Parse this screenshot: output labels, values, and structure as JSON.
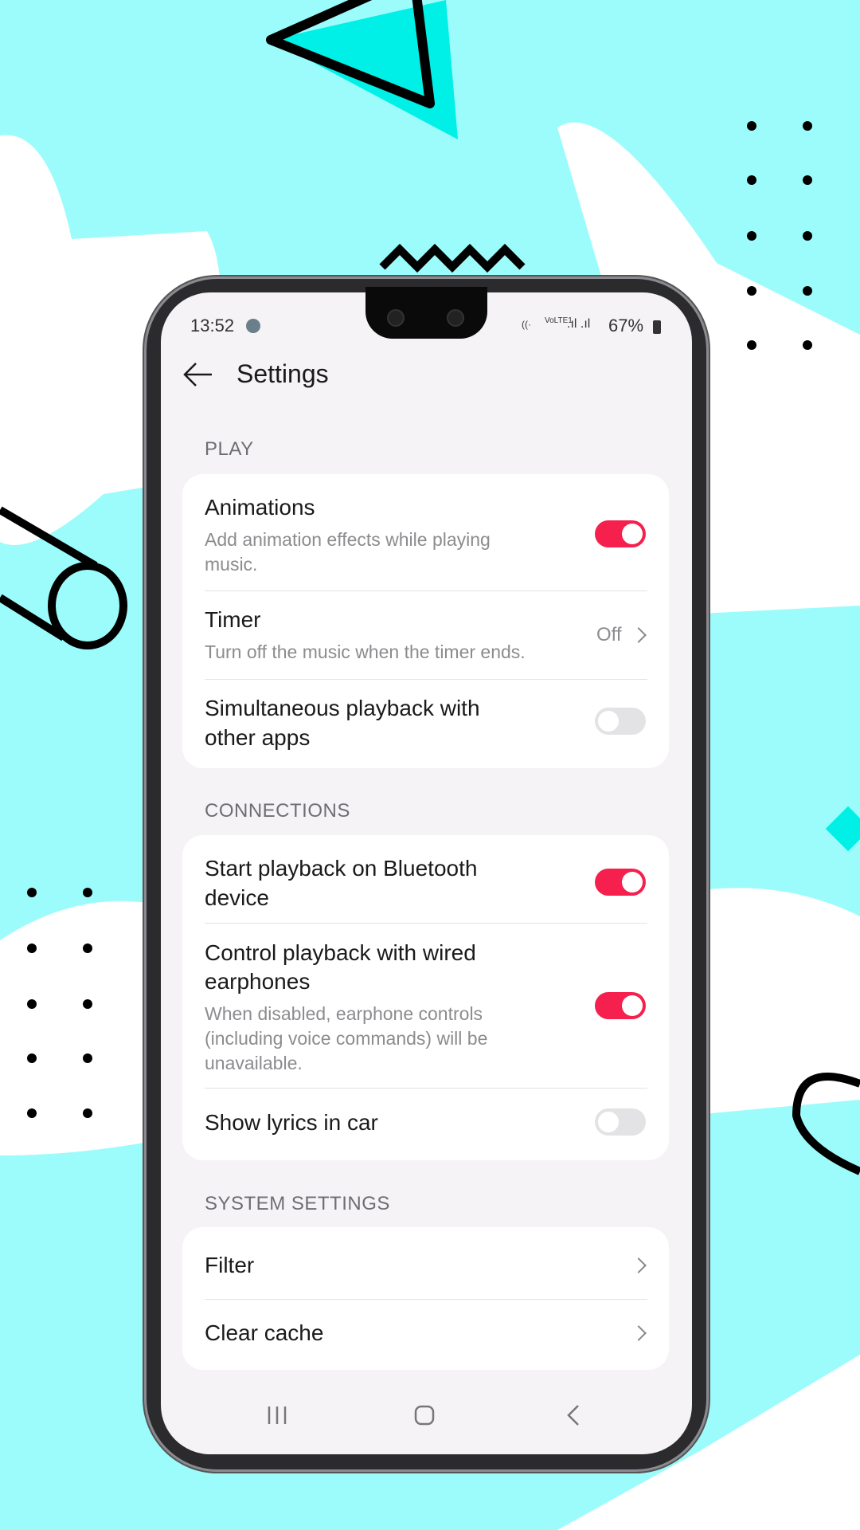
{
  "status_bar": {
    "time": "13:52",
    "battery": "67%",
    "network": "VoLTE1"
  },
  "header": {
    "title": "Settings"
  },
  "sections": [
    {
      "label": "PLAY",
      "items": [
        {
          "title": "Animations",
          "subtitle": [
            "Add animation effects while playing",
            "music."
          ],
          "toggle": true
        },
        {
          "title": "Timer",
          "subtitle": [
            "Turn off the music when the timer ends."
          ],
          "value": "Off"
        },
        {
          "title": [
            "Simultaneous playback with",
            "other apps"
          ],
          "toggle": false
        }
      ]
    },
    {
      "label": "CONNECTIONS",
      "items": [
        {
          "title": [
            "Start playback on Bluetooth",
            "device"
          ],
          "toggle": true
        },
        {
          "title": [
            "Control playback with wired",
            "earphones"
          ],
          "subtitle": [
            "When disabled, earphone controls",
            "(including voice commands) will be",
            "unavailable."
          ],
          "toggle": true
        },
        {
          "title": "Show lyrics in car",
          "toggle": false
        }
      ]
    },
    {
      "label": "SYSTEM SETTINGS",
      "items": [
        {
          "title": "Filter"
        },
        {
          "title": "Clear cache"
        }
      ]
    }
  ],
  "colors": {
    "accent": "#f5204d",
    "background": "#9cfcfb"
  }
}
